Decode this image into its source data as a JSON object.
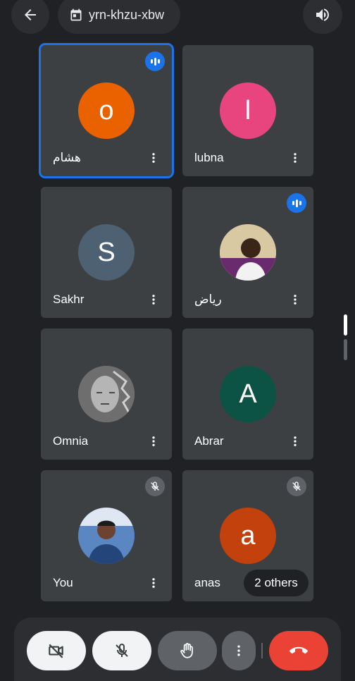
{
  "header": {
    "back_icon": "arrow-left-icon",
    "meeting_code": "yrn-khzu-xbw",
    "calendar_icon": "calendar-icon",
    "audio_icon": "speaker-icon"
  },
  "participants": [
    {
      "name": "هشام",
      "initial": "o",
      "avatar_color": "#ea6100",
      "status": "speaking",
      "active": true
    },
    {
      "name": "lubna",
      "initial": "l",
      "avatar_color": "#e8457f",
      "status": "none"
    },
    {
      "name": "Sakhr",
      "initial": "S",
      "avatar_color": "#4e6172",
      "status": "none"
    },
    {
      "name": "رياض",
      "initial": "",
      "avatar_color": "#c7b98f",
      "photo": true,
      "status": "speaking"
    },
    {
      "name": "Omnia",
      "initial": "",
      "avatar_color": "#8a8a8a",
      "photo": true,
      "status": "none"
    },
    {
      "name": "Abrar",
      "initial": "A",
      "avatar_color": "#0d5345",
      "status": "none"
    },
    {
      "name": "You",
      "initial": "",
      "avatar_color": "#3a6fb0",
      "photo": true,
      "status": "muted"
    },
    {
      "name": "anas",
      "initial": "a",
      "avatar_color": "#c2410c",
      "status": "muted"
    }
  ],
  "others_label": "2 others",
  "controls": {
    "camera_icon": "camera-off-icon",
    "mic_icon": "mic-off-icon",
    "raise_hand_icon": "raise-hand-icon",
    "more_icon": "more-vertical-icon",
    "end_call_icon": "end-call-icon"
  },
  "colors": {
    "background": "#202124",
    "tile": "#3c4043",
    "accent": "#1a73e8",
    "end_call": "#ea4335"
  }
}
